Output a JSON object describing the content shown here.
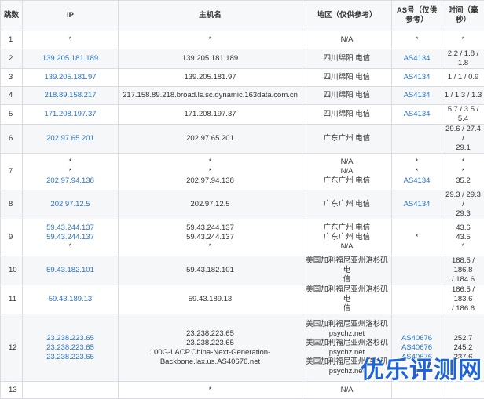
{
  "columns": [
    "跳数",
    "IP",
    "主机名",
    "地区（仅供参考）",
    "AS号（仅供参考）",
    "时间（毫秒）"
  ],
  "rows": [
    {
      "hop": "1",
      "ip": [
        "*"
      ],
      "host": [
        "*"
      ],
      "region": [
        "N/A"
      ],
      "as": [
        "*"
      ],
      "time": [
        "*"
      ]
    },
    {
      "hop": "2",
      "ip": [
        "139.205.181.189"
      ],
      "host": [
        "139.205.181.189"
      ],
      "region": [
        "四川绵阳 电信"
      ],
      "as": [
        "AS4134"
      ],
      "time": [
        "2.2 / 1.8 / 1.8"
      ]
    },
    {
      "hop": "3",
      "ip": [
        "139.205.181.97"
      ],
      "host": [
        "139.205.181.97"
      ],
      "region": [
        "四川绵阳 电信"
      ],
      "as": [
        "AS4134"
      ],
      "time": [
        "1 / 1 / 0.9"
      ]
    },
    {
      "hop": "4",
      "ip": [
        "218.89.158.217"
      ],
      "host": [
        "217.158.89.218.broad.ls.sc.dynamic.163data.com.cn"
      ],
      "region": [
        "四川绵阳 电信"
      ],
      "as": [
        "AS4134"
      ],
      "time": [
        "1 / 1.3 / 1.3"
      ]
    },
    {
      "hop": "5",
      "ip": [
        "171.208.197.37"
      ],
      "host": [
        "171.208.197.37"
      ],
      "region": [
        "四川绵阳 电信"
      ],
      "as": [
        "AS4134"
      ],
      "time": [
        "5.7 / 3.5 / 5.4"
      ]
    },
    {
      "hop": "6",
      "ip": [
        "202.97.65.201"
      ],
      "host": [
        "202.97.65.201"
      ],
      "region": [
        "广东广州 电信"
      ],
      "as": [
        ""
      ],
      "time": [
        "29.6 / 27.4 /",
        "29.1"
      ]
    },
    {
      "hop": "7",
      "ip": [
        "*",
        "*",
        "202.97.94.138"
      ],
      "host": [
        "*",
        "*",
        "202.97.94.138"
      ],
      "region": [
        "N/A",
        "N/A",
        "广东广州 电信"
      ],
      "as": [
        "*",
        "*",
        "AS4134"
      ],
      "time": [
        "*",
        "*",
        "35.2"
      ]
    },
    {
      "hop": "8",
      "ip": [
        "202.97.12.5"
      ],
      "host": [
        "202.97.12.5"
      ],
      "region": [
        "广东广州 电信"
      ],
      "as": [
        "AS4134"
      ],
      "time": [
        "29.3 / 29.3 /",
        "29.3"
      ]
    },
    {
      "hop": "9",
      "ip": [
        "59.43.244.137",
        "59.43.244.137",
        "*"
      ],
      "host": [
        "59.43.244.137",
        "59.43.244.137",
        "*"
      ],
      "region": [
        "广东广州 电信",
        "广东广州 电信",
        "N/A"
      ],
      "as": [
        "",
        "",
        "*"
      ],
      "time": [
        "43.6",
        "43.5",
        "*"
      ]
    },
    {
      "hop": "10",
      "ip": [
        "59.43.182.101"
      ],
      "host": [
        "59.43.182.101"
      ],
      "region": [
        "美国加利福尼亚州洛杉矶 电",
        "信"
      ],
      "as": [
        ""
      ],
      "time": [
        "188.5 / 186.8",
        "/ 184.6"
      ]
    },
    {
      "hop": "11",
      "ip": [
        "59.43.189.13"
      ],
      "host": [
        "59.43.189.13"
      ],
      "region": [
        "美国加利福尼亚州洛杉矶 电",
        "信"
      ],
      "as": [
        ""
      ],
      "time": [
        "186.5 / 183.6",
        "/ 186.6"
      ]
    },
    {
      "hop": "12",
      "ip": [
        "23.238.223.65",
        "23.238.223.65",
        "23.238.223.65"
      ],
      "host": [
        "23.238.223.65",
        "23.238.223.65",
        "100G-LACP.China-Next-Generation-",
        "Backbone.lax.us.AS40676.net"
      ],
      "region": [
        "美国加利福尼亚州洛杉矶",
        "psychz.net",
        "美国加利福尼亚州洛杉矶",
        "psychz.net",
        "美国加利福尼亚州洛杉矶",
        "psychz.net"
      ],
      "as": [
        "AS40676",
        "AS40676",
        "AS40676"
      ],
      "time": [
        "252.7",
        "245.2",
        "237.6"
      ]
    },
    {
      "hop": "13",
      "ip": [
        ""
      ],
      "host": [
        "*"
      ],
      "region": [
        "N/A"
      ],
      "as": [
        ""
      ],
      "time": [
        ""
      ]
    }
  ],
  "watermark": "优乐评测网",
  "colors": {
    "link": "#2a74c4",
    "border": "#d9dde3",
    "watermark": "#1f63d6"
  }
}
